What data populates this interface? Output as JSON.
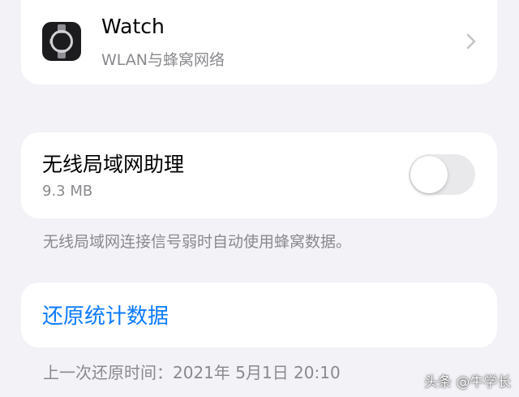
{
  "watch_row": {
    "title": "Watch",
    "subtitle": "WLAN与蜂窝网络",
    "icon": "apple-watch-icon",
    "accessory_icon": "chevron-right-icon"
  },
  "wlan_assist": {
    "title": "无线局域网助理",
    "data_usage": "9.3 MB",
    "enabled": false,
    "footnote": "无线局域网连接信号弱时自动使用蜂窝数据。"
  },
  "reset": {
    "button_label": "还原统计数据",
    "last_reset": "上一次还原时间：2021年 5月1日 20:10"
  },
  "watermark": "头条 @牛学长",
  "colors": {
    "background": "#f2f2f7",
    "card": "#ffffff",
    "link_blue": "#0a7aff",
    "secondary_text": "#8a8a8e",
    "toggle_off": "#e9e9eb"
  }
}
